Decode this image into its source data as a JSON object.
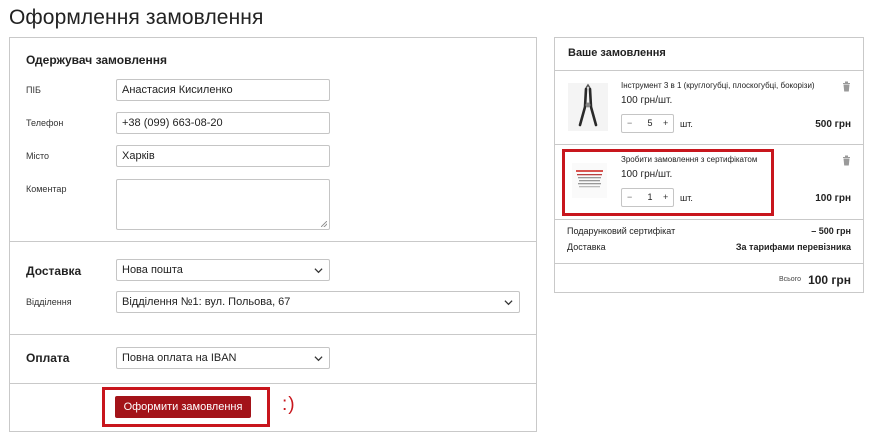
{
  "page_title": "Оформлення замовлення",
  "recipient": {
    "heading": "Одержувач замовлення",
    "name_label": "ПІБ",
    "name_value": "Анастасия Кисиленко",
    "phone_label": "Телефон",
    "phone_value": "+38 (099) 663-08-20",
    "city_label": "Місто",
    "city_value": "Харків",
    "comment_label": "Коментар",
    "comment_value": ""
  },
  "delivery": {
    "heading": "Доставка",
    "method_value": "Нова пошта",
    "branch_label": "Відділення",
    "branch_value": "Відділення №1: вул. Польова, 67"
  },
  "payment": {
    "heading": "Оплата",
    "method_value": "Повна оплата на IBAN"
  },
  "submit": {
    "label": "Оформити замовлення",
    "smiley": ":)"
  },
  "order": {
    "title": "Ваше замовлення",
    "items": [
      {
        "name": "Інструмент 3 в 1 (круглогубці, плоскогубці, бокорізи)",
        "price": "100 грн/шт.",
        "qty": "5",
        "unit": "шт.",
        "total": "500 грн",
        "icon": "pliers-product-image"
      },
      {
        "name": "Зробити замовлення з сертифікатом",
        "price": "100 грн/шт.",
        "qty": "1",
        "unit": "шт.",
        "total": "100 грн",
        "icon": "certificate-product-image"
      }
    ],
    "certificate_label": "Подарунковий сертифікат",
    "certificate_value": "– 500 грн",
    "delivery_label": "Доставка",
    "delivery_value": "За тарифами перевізника",
    "total_label": "Всього",
    "total_value": "100 грн"
  },
  "colors": {
    "accent": "#a31319",
    "highlight": "#c8161d",
    "border": "#c9c9c9"
  }
}
